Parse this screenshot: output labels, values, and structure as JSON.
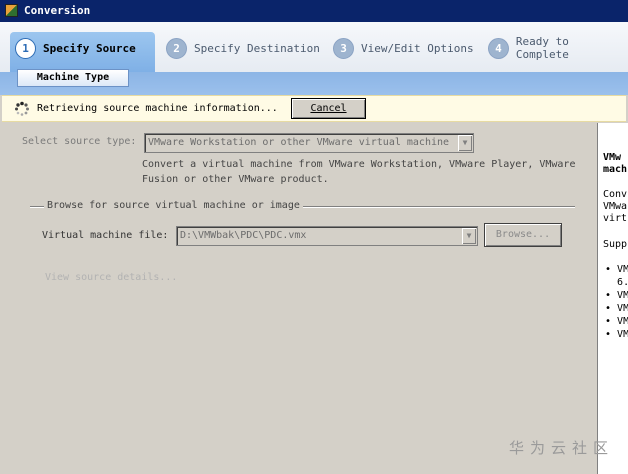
{
  "window": {
    "title": "Conversion"
  },
  "steps": [
    {
      "num": "1",
      "label": "Specify Source"
    },
    {
      "num": "2",
      "label": "Specify Destination"
    },
    {
      "num": "3",
      "label": "View/Edit Options"
    },
    {
      "num": "4",
      "label": "Ready to Complete"
    }
  ],
  "subtab": {
    "label": "Machine Type"
  },
  "status": {
    "message": "Retrieving source machine information...",
    "cancel_label": "Cancel"
  },
  "source": {
    "type_label": "Select source type:",
    "type_value": "VMware Workstation or other VMware virtual machine",
    "description_line1": "Convert a virtual machine from VMware Workstation, VMware Player, VMware",
    "description_line2": "Fusion or other VMware product.",
    "group_title": "Browse for source virtual machine or image",
    "file_label": "Virtual machine file:",
    "file_value": "D:\\VMWbak\\PDC\\PDC.vmx",
    "browse_label": "Browse...",
    "view_details": "View source details..."
  },
  "help": {
    "heading1": "VMw",
    "heading2": "mach",
    "line1": "Conv",
    "line2": "VMwa",
    "line3": "virt",
    "line4": "Supp",
    "bullets": [
      "VM",
      "6.",
      "VM",
      "VM",
      "VM",
      "VM"
    ]
  },
  "watermark": "华为云社区"
}
